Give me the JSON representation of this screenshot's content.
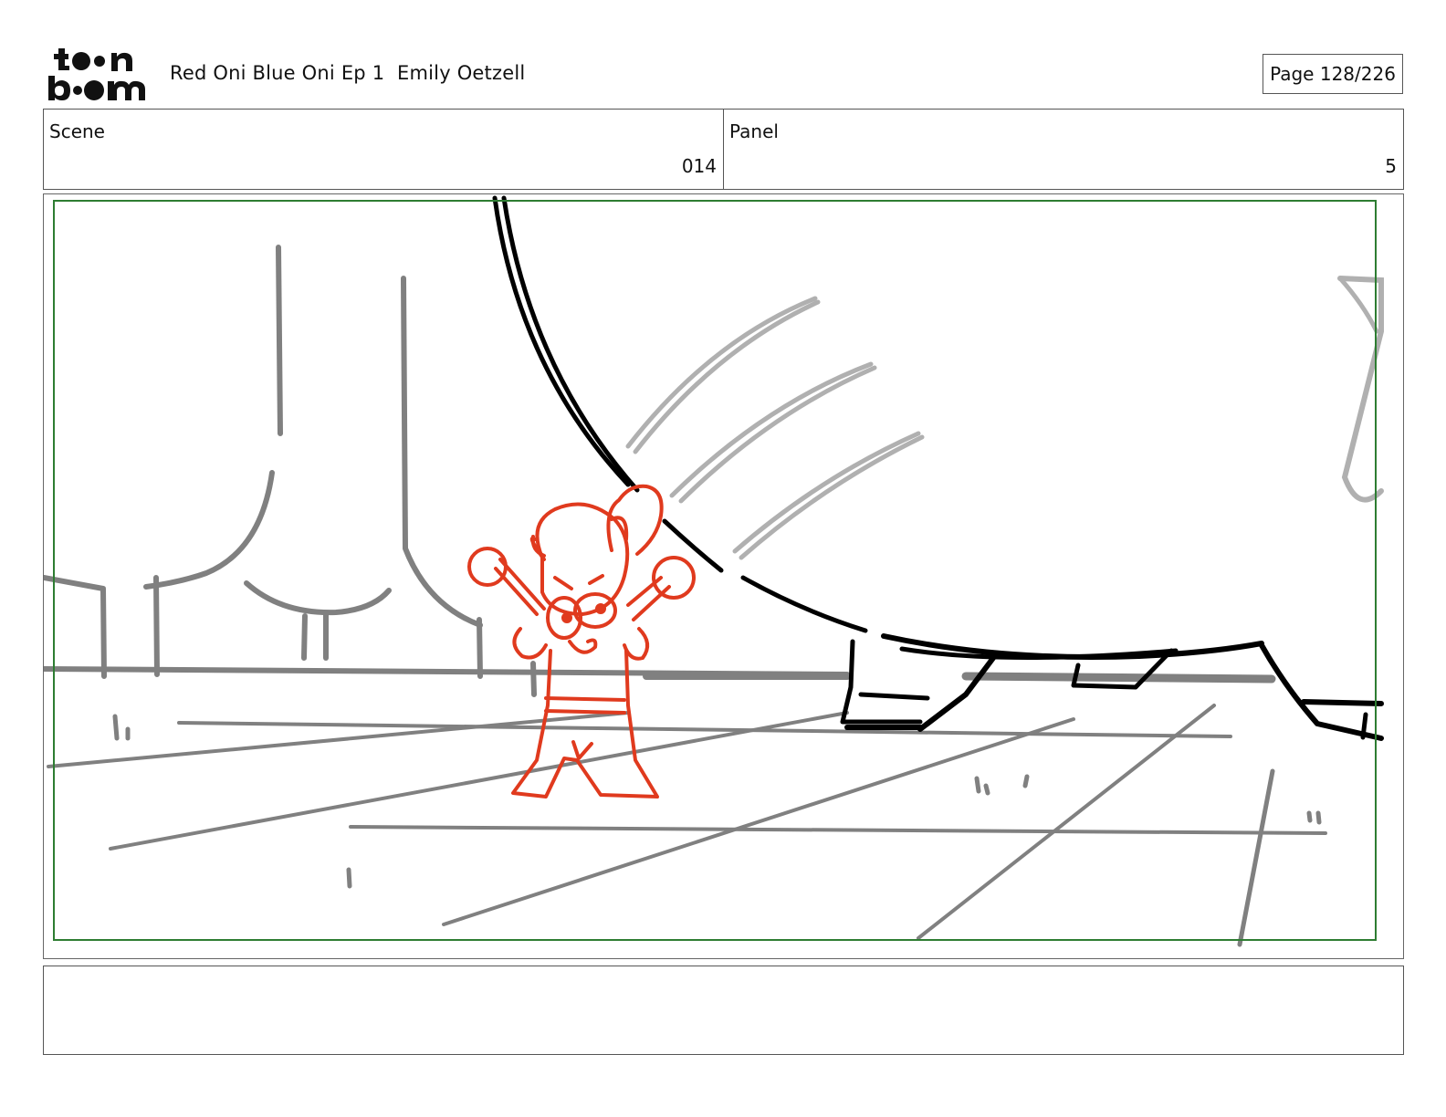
{
  "header": {
    "logo_text_top": "toon",
    "logo_text_bottom": "boom",
    "project_title": "Red Oni Blue Oni Ep 1  Emily Oetzell",
    "page_indicator": "Page 128/226"
  },
  "info": {
    "scene_label": "Scene",
    "scene_value": "014",
    "panel_label": "Panel",
    "panel_value": "5"
  },
  "panel": {
    "safe_frame_color": "#2e7d32",
    "sketch_color_bg": "#808080",
    "sketch_color_light": "#b0b0b0",
    "sketch_color_character": "#e03a1e",
    "sketch_color_ink": "#000000"
  },
  "notes": {
    "text": ""
  }
}
